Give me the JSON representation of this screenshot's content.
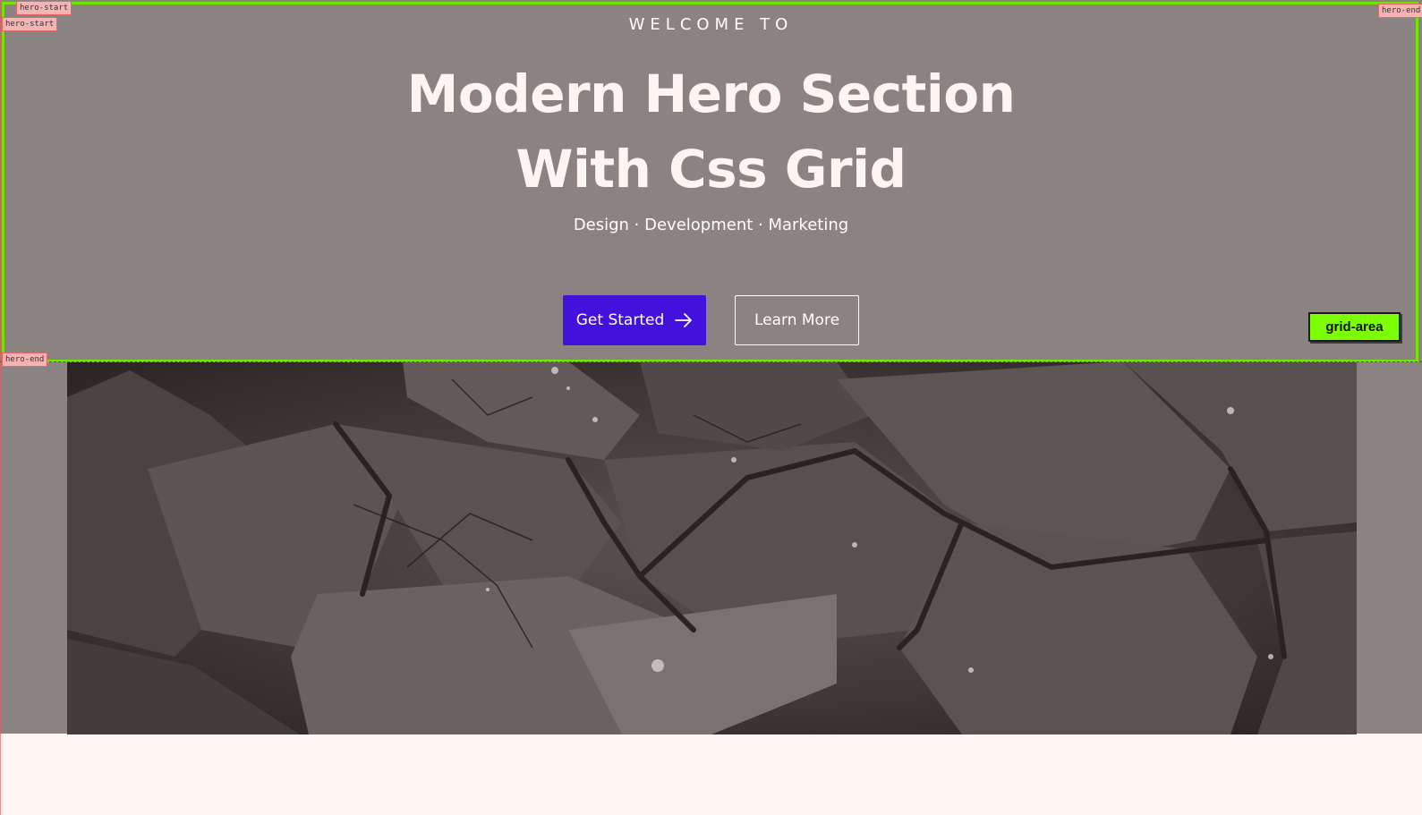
{
  "hero": {
    "eyebrow": "WELCOME TO",
    "title_line1": "Modern Hero Section",
    "title_line2": "With Css Grid",
    "tagline": "Design · Development · Marketing",
    "primary_button": "Get Started",
    "secondary_button": "Learn More",
    "image": "cracked-stone-photo"
  },
  "devtools_overlay": {
    "area_badge": "grid-area",
    "line_labels": {
      "top_start_1": "hero-start",
      "top_start_2": "hero-start",
      "top_end": "hero-end",
      "bottom_end": "hero-end"
    },
    "outline_color": "#73e600"
  },
  "colors": {
    "hero_bg": "#8b8382",
    "primary_button_bg": "#4311dc",
    "page_bg": "#fff6f4"
  }
}
